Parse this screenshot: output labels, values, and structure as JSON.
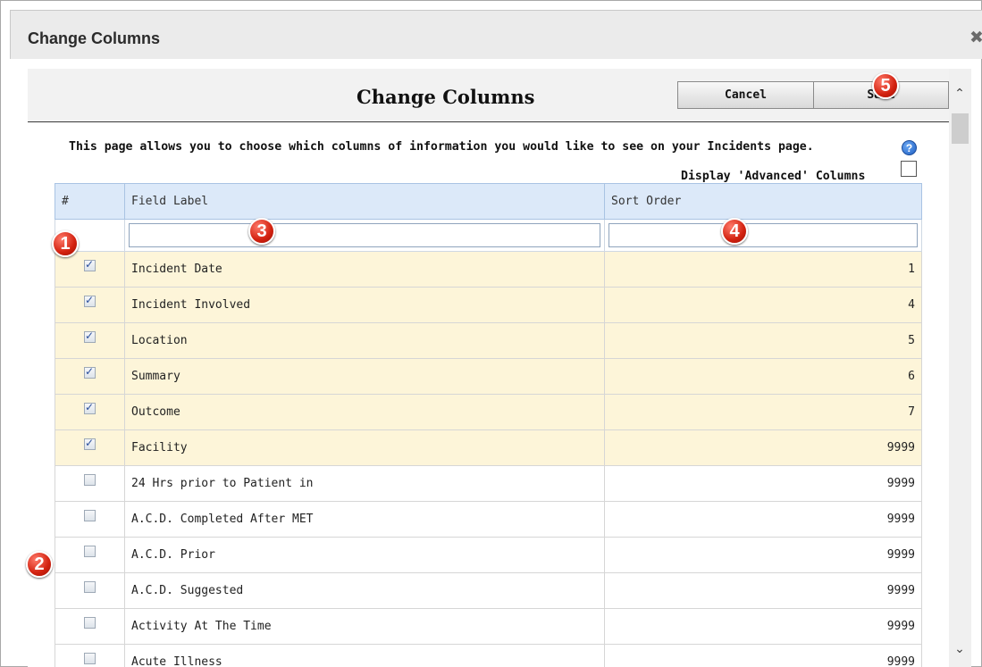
{
  "dialog": {
    "title": "Change Columns",
    "close_glyph": "✖"
  },
  "page": {
    "title": "Change Columns",
    "cancel_label": "Cancel",
    "save_label": "Save",
    "description": "This page allows you to choose which columns of information you would like to see on your Incidents page.",
    "help_glyph": "?",
    "advanced_label": "Display 'Advanced' Columns",
    "advanced_checked": false
  },
  "table": {
    "headers": {
      "num": "#",
      "field": "Field Label",
      "sort": "Sort Order"
    },
    "filters": {
      "field_value": "",
      "sort_value": ""
    },
    "rows": [
      {
        "checked": true,
        "label": "Incident Date",
        "sort": "1"
      },
      {
        "checked": true,
        "label": "Incident Involved",
        "sort": "4"
      },
      {
        "checked": true,
        "label": "Location",
        "sort": "5"
      },
      {
        "checked": true,
        "label": "Summary",
        "sort": "6"
      },
      {
        "checked": true,
        "label": "Outcome",
        "sort": "7"
      },
      {
        "checked": true,
        "label": "Facility",
        "sort": "9999"
      },
      {
        "checked": false,
        "label": "24 Hrs prior to Patient in",
        "sort": "9999"
      },
      {
        "checked": false,
        "label": "A.C.D. Completed After MET",
        "sort": "9999"
      },
      {
        "checked": false,
        "label": "A.C.D. Prior",
        "sort": "9999"
      },
      {
        "checked": false,
        "label": "A.C.D. Suggested",
        "sort": "9999"
      },
      {
        "checked": false,
        "label": "Activity At The Time",
        "sort": "9999"
      },
      {
        "checked": false,
        "label": "Acute Illness",
        "sort": "9999"
      }
    ]
  },
  "scrollbar": {
    "up_glyph": "⌃",
    "down_glyph": "⌄"
  },
  "markers": [
    "1",
    "2",
    "3",
    "4",
    "5"
  ],
  "colors": {
    "selected_row": "#fdf5d9",
    "header_bg": "#dce9f9",
    "marker_red": "#d2210f"
  }
}
